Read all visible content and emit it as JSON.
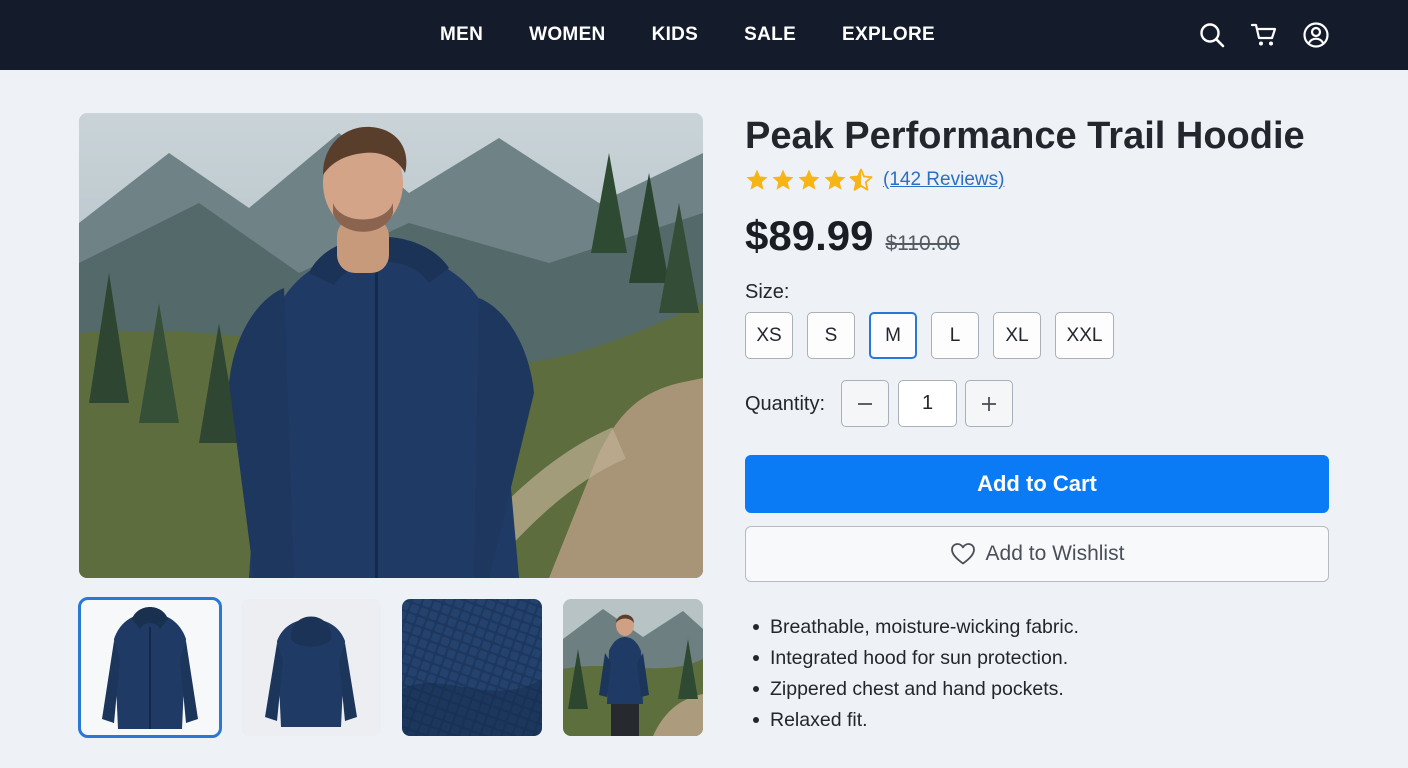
{
  "nav": {
    "links": [
      "MEN",
      "WOMEN",
      "KIDS",
      "SALE",
      "EXPLORE"
    ],
    "icons": [
      "search-icon",
      "cart-icon",
      "user-account-icon"
    ]
  },
  "product": {
    "title": "Peak Performance Trail Hoodie",
    "rating": 4.5,
    "rating_max": 5,
    "reviews_label": "(142 Reviews)",
    "price": "$89.99",
    "original_price": "$110.00"
  },
  "size": {
    "label": "Size:",
    "options": [
      "XS",
      "S",
      "M",
      "L",
      "XL",
      "XXL"
    ],
    "selected": "M"
  },
  "quantity": {
    "label": "Quantity:",
    "value": "1",
    "decrement_icon": "minus-icon",
    "increment_icon": "plus-icon"
  },
  "actions": {
    "add_to_cart": "Add to Cart",
    "add_to_wishlist": "Add to Wishlist",
    "wishlist_icon": "heart-icon"
  },
  "features": [
    "Breathable, moisture-wicking fabric.",
    "Integrated hood for sun protection.",
    "Zippered chest and hand pockets.",
    "Relaxed fit."
  ],
  "gallery": {
    "thumbnails": [
      "front-view",
      "back-view",
      "fabric-detail",
      "lifestyle-hiking"
    ],
    "selected_index": 0
  },
  "colors": {
    "nav_bg": "#141c2b",
    "primary": "#0a7bf5",
    "star": "#f6b417",
    "link": "#2a6fc1",
    "hoodie": "#1f3a64"
  }
}
